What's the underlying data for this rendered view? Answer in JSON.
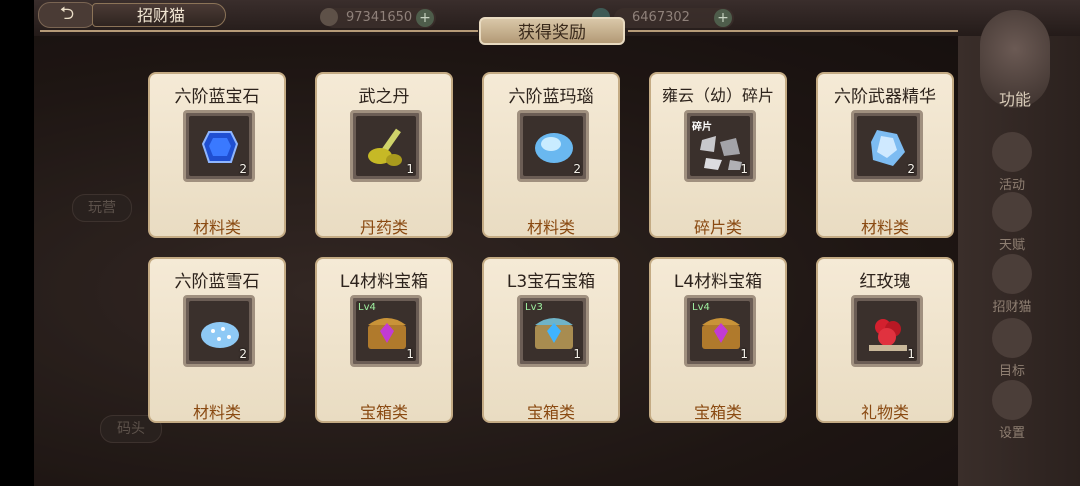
{
  "app": {
    "title": "招财猫",
    "back_icon": "back-arrow-icon"
  },
  "currency": [
    {
      "value": "97341650",
      "icon": "coin-icon"
    },
    {
      "value": "6467302",
      "icon": "gem-icon"
    }
  ],
  "side_menu": {
    "function_label": "功能",
    "items": [
      {
        "label": "活动",
        "icon": "star-icon"
      },
      {
        "label": "天赋",
        "icon": "wings-icon"
      },
      {
        "label": "招财猫",
        "icon": "cat-icon"
      },
      {
        "label": "目标",
        "icon": "clipboard-icon"
      },
      {
        "label": "设置",
        "icon": "gear-icon"
      }
    ]
  },
  "left_background": {
    "pill1": "玩营",
    "pill2": "码头"
  },
  "reward_panel": {
    "title": "获得奖励",
    "items": [
      {
        "name": "六阶蓝宝石",
        "qty": "2",
        "category": "材料类",
        "icon": "blue-sapphire-icon"
      },
      {
        "name": "武之丹",
        "qty": "1",
        "category": "丹药类",
        "icon": "gold-pill-sword-icon"
      },
      {
        "name": "六阶蓝玛瑙",
        "qty": "2",
        "category": "材料类",
        "icon": "blue-agate-icon"
      },
      {
        "name": "雍云（幼）碎片",
        "qty": "1",
        "category": "碎片类",
        "icon": "shard-fragment-icon",
        "badge": "碎片"
      },
      {
        "name": "六阶武器精华",
        "qty": "2",
        "category": "材料类",
        "icon": "blue-crystal-icon"
      },
      {
        "name": "六阶蓝雪石",
        "qty": "2",
        "category": "材料类",
        "icon": "snow-stone-icon"
      },
      {
        "name": "L4材料宝箱",
        "qty": "1",
        "category": "宝箱类",
        "icon": "chest-purple-gem-icon",
        "badge": "Lv4"
      },
      {
        "name": "L3宝石宝箱",
        "qty": "1",
        "category": "宝箱类",
        "icon": "chest-blue-gem-icon",
        "badge": "Lv3"
      },
      {
        "name": "L4材料宝箱",
        "qty": "1",
        "category": "宝箱类",
        "icon": "chest-purple-gem-icon",
        "badge": "Lv4"
      },
      {
        "name": "红玫瑰",
        "qty": "1",
        "category": "礼物类",
        "icon": "red-rose-icon"
      }
    ]
  },
  "colors": {
    "card_bg": "#f3e7d1",
    "card_border": "#c4ab84",
    "category_text": "#8a4a12",
    "header_bg": "#c9b48f"
  }
}
